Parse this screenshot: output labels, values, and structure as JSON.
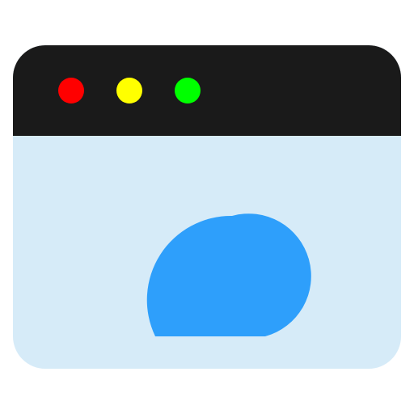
{
  "window": {
    "titlebar_color": "#1a1a1a",
    "content_color": "#d6ebf8",
    "buttons": [
      {
        "role": "close",
        "color": "#ff0000"
      },
      {
        "role": "minimize",
        "color": "#ffff00"
      },
      {
        "role": "maximize",
        "color": "#00ff00"
      }
    ]
  },
  "content": {
    "icon": "cloud-icon",
    "icon_color": "#2e9ffb"
  }
}
